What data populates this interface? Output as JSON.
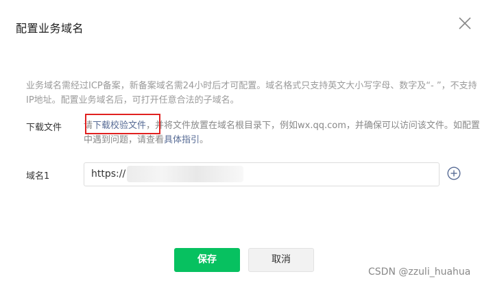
{
  "dialog": {
    "title": "配置业务域名",
    "description": "业务域名需经过ICP备案，新备案域名需24小时后才可配置。域名格式只支持英文大小写字母、数字及“- ”，不支持IP地址。配置业务域名后，可打开任意合法的子域名。"
  },
  "download": {
    "label": "下载文件",
    "prefix": "请",
    "link": "下载校验文件",
    "middle": "，并将文件放置在域名根目录下，例如wx.qq.com，并确保可以访问该文件。如配置中遇到问题，请查看",
    "guide_link": "具体指引",
    "suffix": "。"
  },
  "domain": {
    "label": "域名1",
    "value": "https://"
  },
  "buttons": {
    "save": "保存",
    "cancel": "取消"
  },
  "watermark": "CSDN @zzuli_huahua",
  "colors": {
    "primary": "#07c160",
    "link": "#576b95",
    "highlight": "#e0201f"
  }
}
